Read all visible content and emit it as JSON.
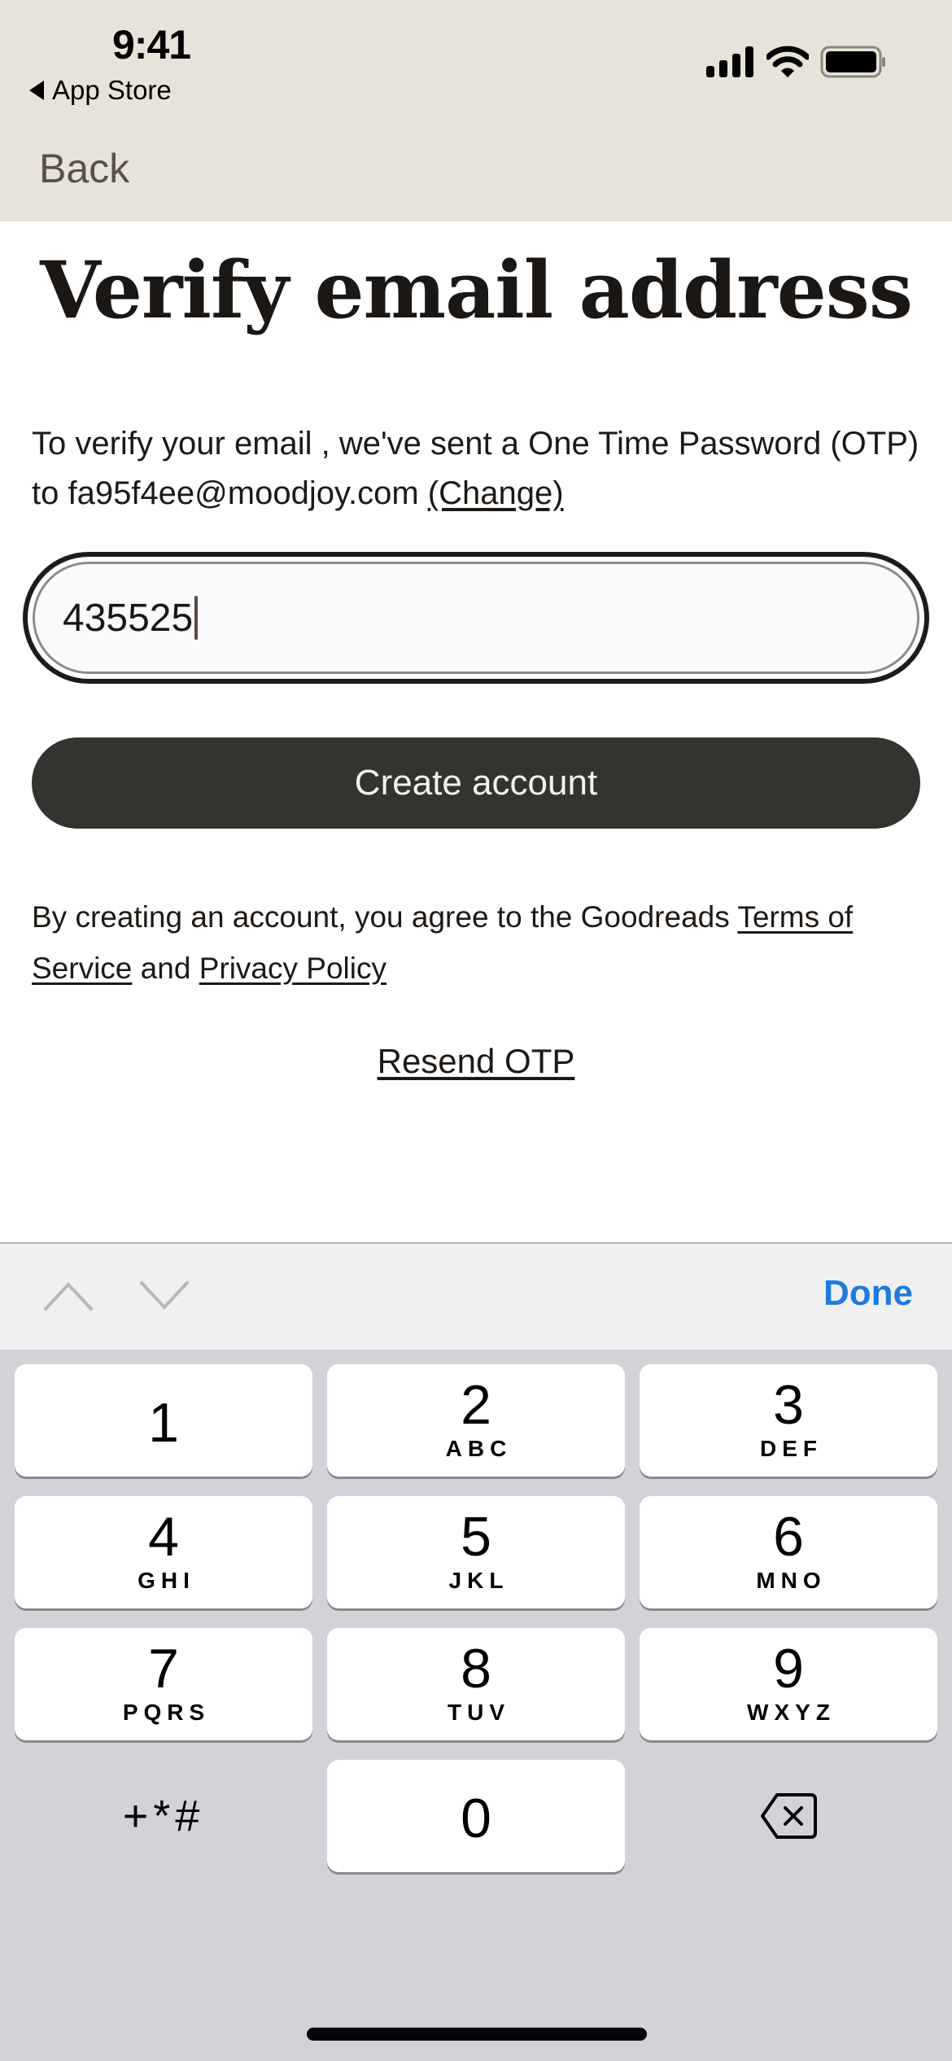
{
  "status_bar": {
    "time": "9:41",
    "back_app_label": "App Store",
    "icons": [
      "cellular-signal-icon",
      "wifi-icon",
      "battery-icon"
    ]
  },
  "nav": {
    "back_label": "Back"
  },
  "page": {
    "title": "Verify email address",
    "intro_text": "To verify your email , we've sent a One Time Password (OTP) to fa95f4ee@moodjoy.com ",
    "change_link": "(Change)",
    "otp_value": "435525",
    "create_button": "Create account",
    "legal_prefix": "By creating an account, you agree to the Goodreads ",
    "terms_link": "Terms of Service",
    "legal_and": " and ",
    "privacy_link": "Privacy Policy",
    "resend_link": "Resend OTP"
  },
  "keyboard_accessory": {
    "prev_icon": "chevron-up-icon",
    "next_icon": "chevron-down-icon",
    "done_label": "Done",
    "done_color": "#1f7ae0"
  },
  "keypad": {
    "keys": [
      {
        "num": "1",
        "letters": ""
      },
      {
        "num": "2",
        "letters": "ABC"
      },
      {
        "num": "3",
        "letters": "DEF"
      },
      {
        "num": "4",
        "letters": "GHI"
      },
      {
        "num": "5",
        "letters": "JKL"
      },
      {
        "num": "6",
        "letters": "MNO"
      },
      {
        "num": "7",
        "letters": "PQRS"
      },
      {
        "num": "8",
        "letters": "TUV"
      },
      {
        "num": "9",
        "letters": "WXYZ"
      },
      {
        "num": "0",
        "letters": ""
      }
    ],
    "symbols_label": "+*#",
    "delete_icon": "backspace-icon"
  },
  "colors": {
    "header_bg": "#e7e3d8",
    "button_bg": "#323430",
    "keypad_bg": "#d2d3d8"
  }
}
